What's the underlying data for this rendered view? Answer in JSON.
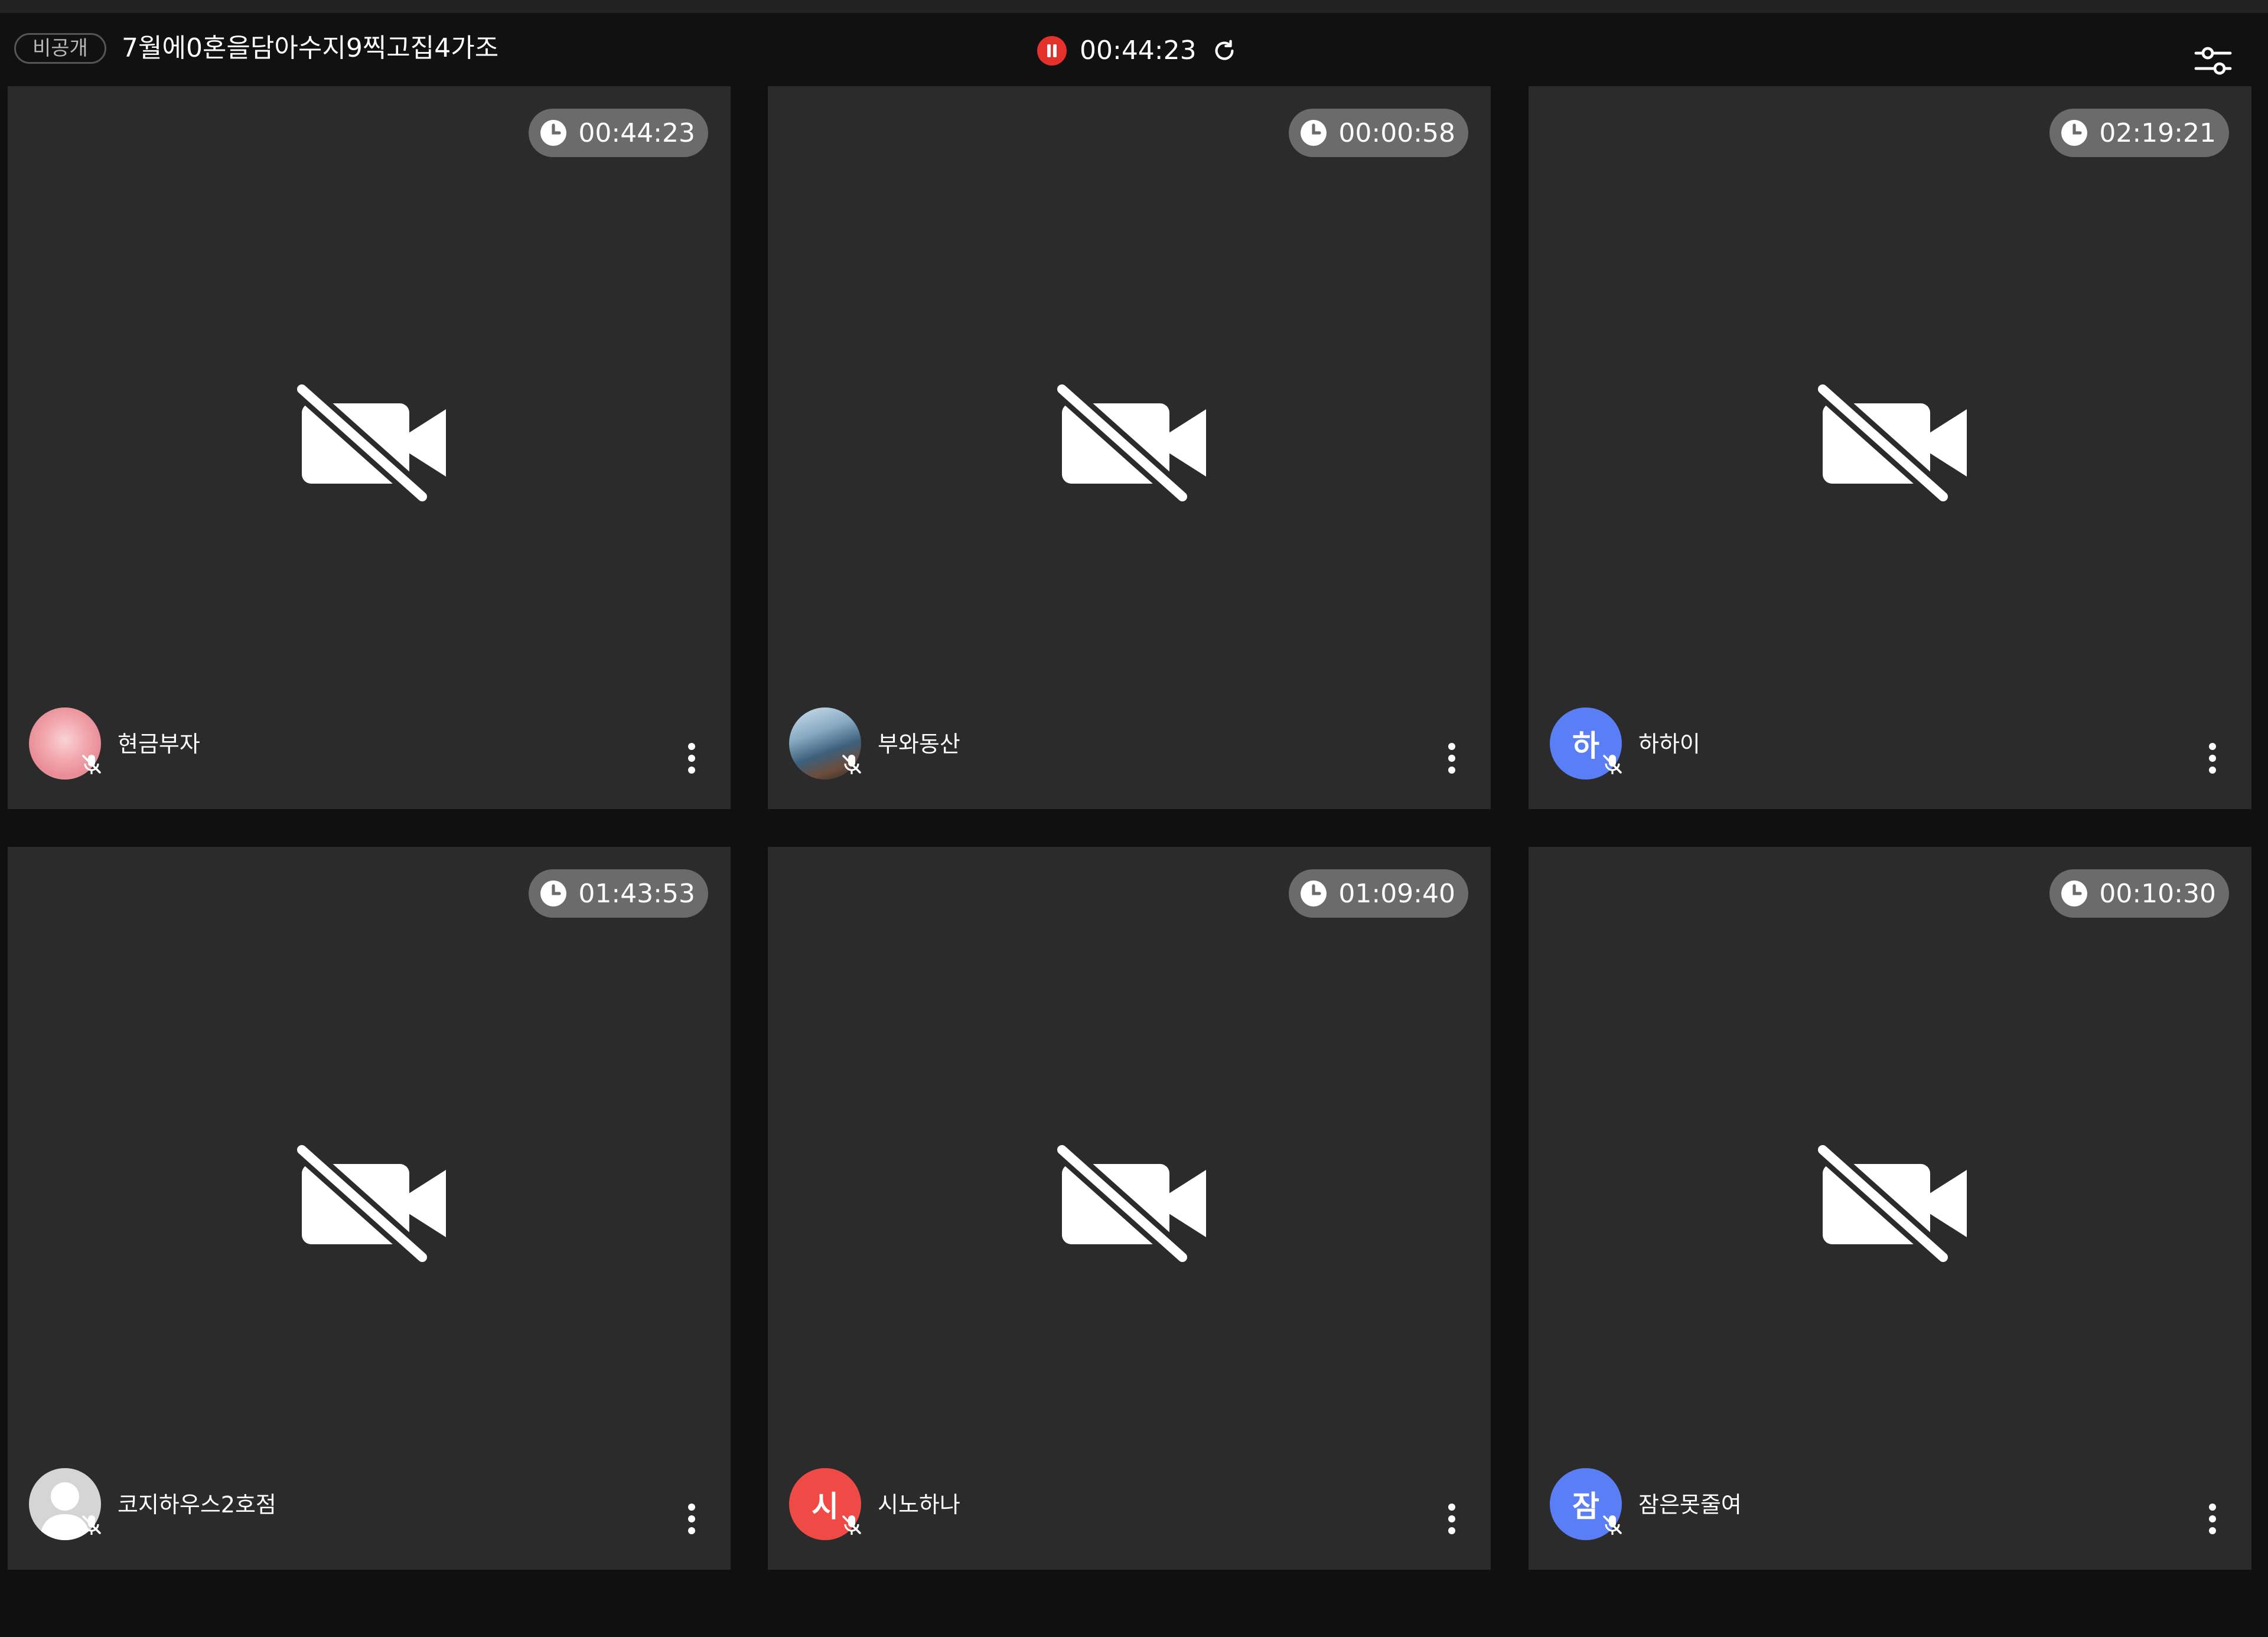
{
  "header": {
    "visibility_badge": "비공개",
    "room_title": "7월에0혼을담아수지9찍고집4가조",
    "session_timer": "00:44:23",
    "recording_color": "#e5312b",
    "icons": {
      "recording": "pause-record-icon",
      "refresh": "refresh-icon",
      "settings": "settings-sliders-icon"
    }
  },
  "participants": [
    {
      "name": "현금부자",
      "timer": "00:44:23",
      "avatar_type": "image",
      "avatar_initial": "",
      "camera": "off",
      "mic": "off"
    },
    {
      "name": "부와동산",
      "timer": "00:00:58",
      "avatar_type": "image",
      "avatar_initial": "",
      "camera": "off",
      "mic": "off"
    },
    {
      "name": "하하이",
      "timer": "02:19:21",
      "avatar_type": "initial",
      "avatar_initial": "하",
      "avatar_color": "#5a7ef5",
      "camera": "off",
      "mic": "off"
    },
    {
      "name": "코지하우스2호점",
      "timer": "01:43:53",
      "avatar_type": "default-silhouette",
      "avatar_initial": "",
      "camera": "off",
      "mic": "off"
    },
    {
      "name": "시노하나",
      "timer": "01:09:40",
      "avatar_type": "initial",
      "avatar_initial": "시",
      "avatar_color": "#f04a47",
      "camera": "off",
      "mic": "off"
    },
    {
      "name": "잠은못줄여",
      "timer": "00:10:30",
      "avatar_type": "initial",
      "avatar_initial": "잠",
      "avatar_color": "#5a7ef5",
      "camera": "off",
      "mic": "off"
    }
  ],
  "colors": {
    "background": "#101010",
    "tile": "#2b2b2b",
    "timer_pill": "#6b6b6b"
  }
}
